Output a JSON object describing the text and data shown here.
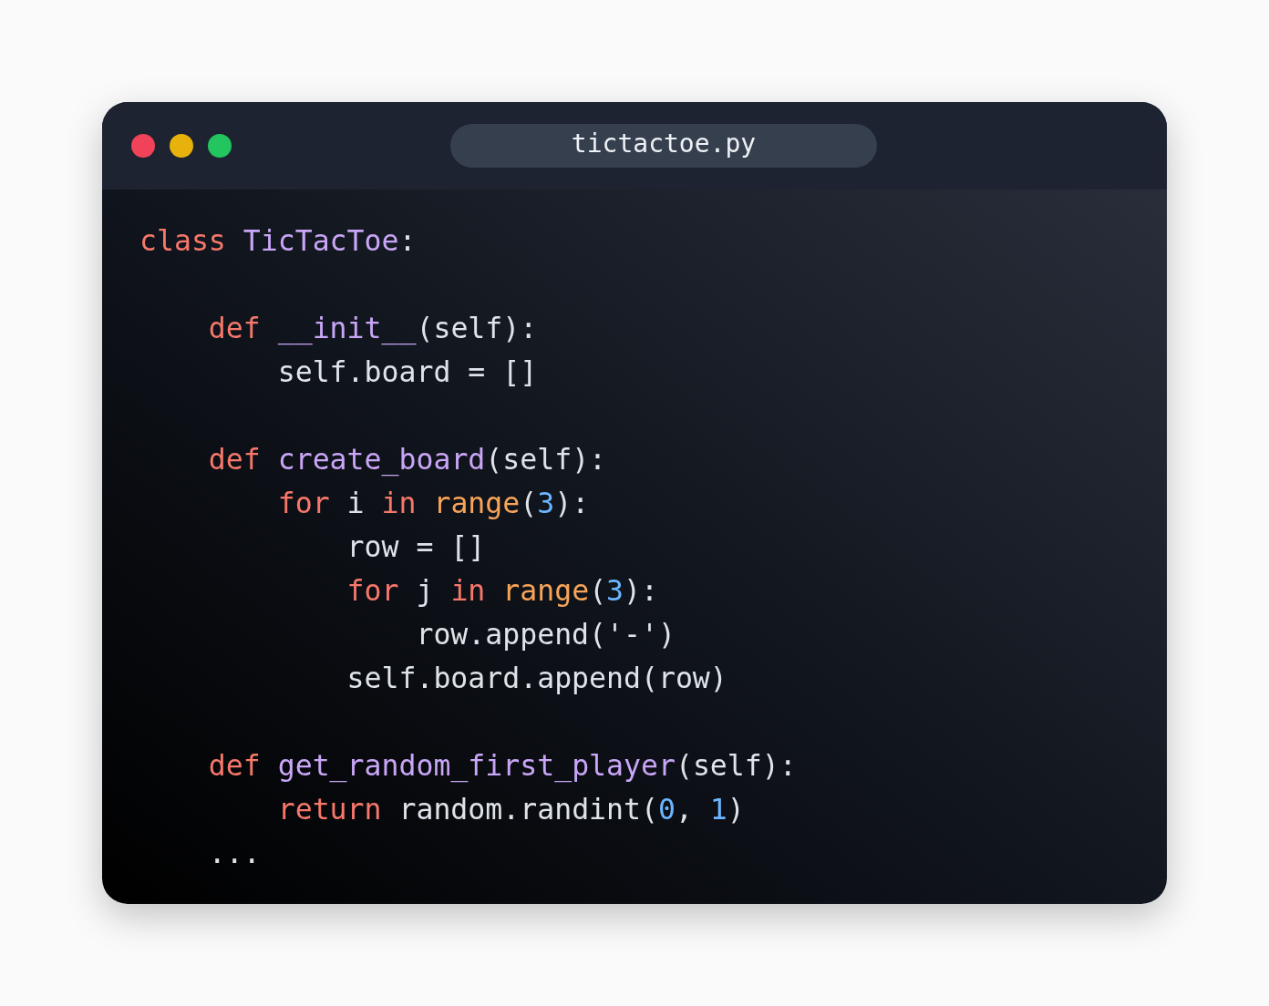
{
  "window": {
    "title": "tictactoe.py",
    "controls": [
      {
        "kind": "close",
        "color": "#f0435a"
      },
      {
        "kind": "minimize",
        "color": "#e8b20c"
      },
      {
        "kind": "maximize",
        "color": "#22c55e"
      }
    ]
  },
  "code_blocks": [
    [
      [
        {
          "kind": "keyword",
          "text": "class"
        },
        {
          "kind": "name",
          "text": " TicTacToe"
        },
        {
          "kind": "plain",
          "text": ":"
        }
      ]
    ],
    [
      [
        {
          "kind": "keyword",
          "text": "    def"
        },
        {
          "kind": "name",
          "text": " __init__"
        },
        {
          "kind": "plain",
          "text": "(self):"
        }
      ],
      [
        {
          "kind": "plain",
          "text": "        self.board = []"
        }
      ]
    ],
    [
      [
        {
          "kind": "keyword",
          "text": "    def"
        },
        {
          "kind": "name",
          "text": " create_board"
        },
        {
          "kind": "plain",
          "text": "(self):"
        }
      ],
      [
        {
          "kind": "keyword",
          "text": "        for"
        },
        {
          "kind": "plain",
          "text": " i "
        },
        {
          "kind": "keyword",
          "text": "in"
        },
        {
          "kind": "builtin",
          "text": " range"
        },
        {
          "kind": "plain",
          "text": "("
        },
        {
          "kind": "number",
          "text": "3"
        },
        {
          "kind": "plain",
          "text": "):"
        }
      ],
      [
        {
          "kind": "plain",
          "text": "            row = []"
        }
      ],
      [
        {
          "kind": "keyword",
          "text": "            for"
        },
        {
          "kind": "plain",
          "text": " j "
        },
        {
          "kind": "keyword",
          "text": "in"
        },
        {
          "kind": "builtin",
          "text": " range"
        },
        {
          "kind": "plain",
          "text": "("
        },
        {
          "kind": "number",
          "text": "3"
        },
        {
          "kind": "plain",
          "text": "):"
        }
      ],
      [
        {
          "kind": "plain",
          "text": "                row.append('-')"
        }
      ],
      [
        {
          "kind": "plain",
          "text": "            self.board.append(row)"
        }
      ]
    ],
    [
      [
        {
          "kind": "keyword",
          "text": "    def"
        },
        {
          "kind": "name",
          "text": " get_random_first_player"
        },
        {
          "kind": "plain",
          "text": "(self):"
        }
      ],
      [
        {
          "kind": "keyword",
          "text": "        return"
        },
        {
          "kind": "plain",
          "text": " random.randint("
        },
        {
          "kind": "number",
          "text": "0"
        },
        {
          "kind": "plain",
          "text": ", "
        },
        {
          "kind": "number",
          "text": "1"
        },
        {
          "kind": "plain",
          "text": ")"
        }
      ],
      [
        {
          "kind": "plain",
          "text": "    ..."
        }
      ]
    ]
  ]
}
